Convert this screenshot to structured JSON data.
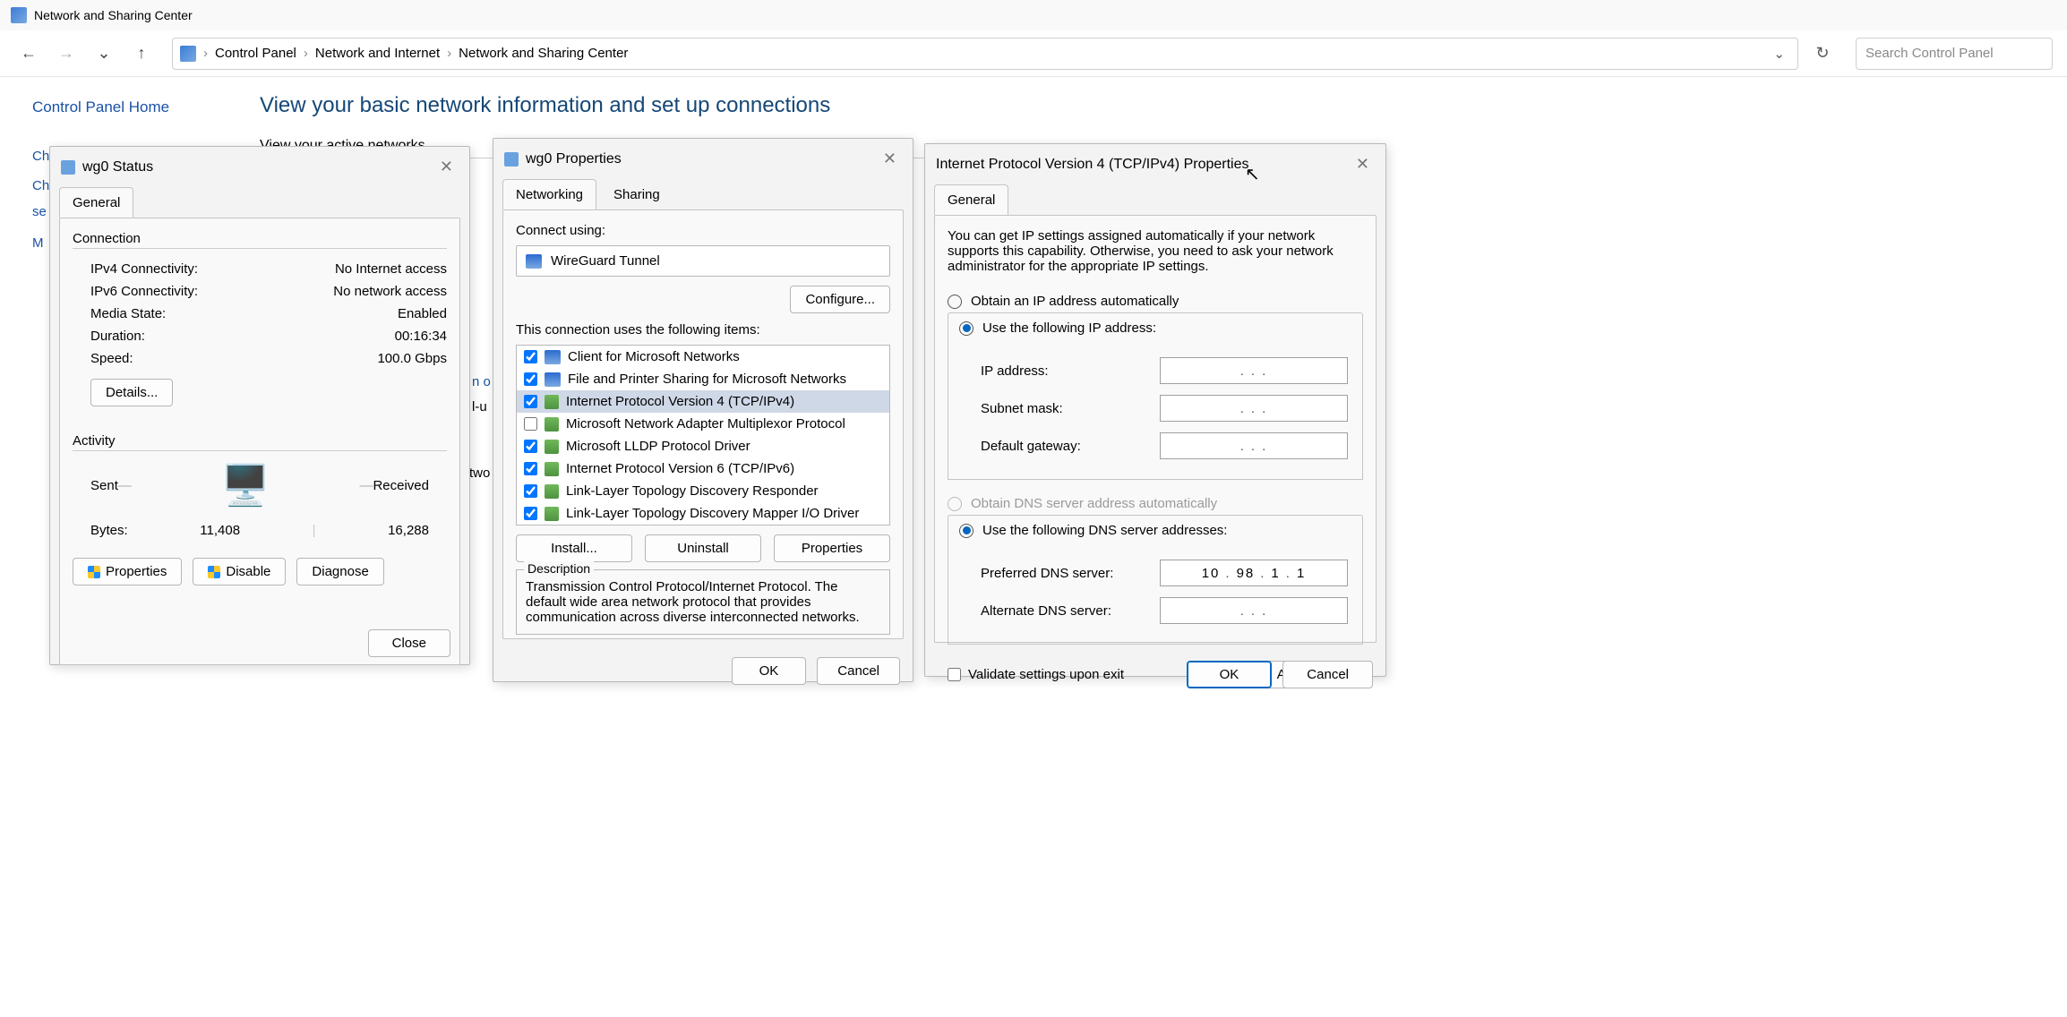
{
  "window": {
    "title": "Network and Sharing Center"
  },
  "toolbar": {
    "breadcrumb": [
      "Control Panel",
      "Network and Internet",
      "Network and Sharing Center"
    ],
    "search_placeholder": "Search Control Panel"
  },
  "sidebar": {
    "home": "Control Panel Home",
    "links": [
      "Change adapter settings",
      "Ch",
      "se",
      "M"
    ]
  },
  "content": {
    "heading": "View your basic network information and set up connections",
    "subhead": "View your active networks",
    "peek1": "n o",
    "peek2": "l-u",
    "peek3": "two"
  },
  "status": {
    "title": "wg0 Status",
    "tab": "General",
    "section_conn": "Connection",
    "ipv4_l": "IPv4 Connectivity:",
    "ipv4_v": "No Internet access",
    "ipv6_l": "IPv6 Connectivity:",
    "ipv6_v": "No network access",
    "media_l": "Media State:",
    "media_v": "Enabled",
    "dur_l": "Duration:",
    "dur_v": "00:16:34",
    "speed_l": "Speed:",
    "speed_v": "100.0 Gbps",
    "details": "Details...",
    "section_act": "Activity",
    "sent_l": "Sent",
    "recv_l": "Received",
    "bytes_l": "Bytes:",
    "sent_v": "11,408",
    "recv_v": "16,288",
    "props": "Properties",
    "disable": "Disable",
    "diag": "Diagnose",
    "close": "Close"
  },
  "props": {
    "title": "wg0 Properties",
    "tab_net": "Networking",
    "tab_share": "Sharing",
    "connect_using": "Connect using:",
    "adapter": "WireGuard Tunnel",
    "configure": "Configure...",
    "items_label": "This connection uses the following items:",
    "items": [
      {
        "checked": true,
        "icon": "pc",
        "label": "Client for Microsoft Networks"
      },
      {
        "checked": true,
        "icon": "pc",
        "label": "File and Printer Sharing for Microsoft Networks"
      },
      {
        "checked": true,
        "icon": "net",
        "label": "Internet Protocol Version 4 (TCP/IPv4)",
        "selected": true
      },
      {
        "checked": false,
        "icon": "net",
        "label": "Microsoft Network Adapter Multiplexor Protocol"
      },
      {
        "checked": true,
        "icon": "net",
        "label": "Microsoft LLDP Protocol Driver"
      },
      {
        "checked": true,
        "icon": "net",
        "label": "Internet Protocol Version 6 (TCP/IPv6)"
      },
      {
        "checked": true,
        "icon": "net",
        "label": "Link-Layer Topology Discovery Responder"
      },
      {
        "checked": true,
        "icon": "net",
        "label": "Link-Layer Topology Discovery Mapper I/O Driver"
      }
    ],
    "install": "Install...",
    "uninstall": "Uninstall",
    "properties": "Properties",
    "desc_legend": "Description",
    "desc": "Transmission Control Protocol/Internet Protocol. The default wide area network protocol that provides communication across diverse interconnected networks.",
    "ok": "OK",
    "cancel": "Cancel"
  },
  "ipv4": {
    "title": "Internet Protocol Version 4 (TCP/IPv4) Properties",
    "tab": "General",
    "intro": "You can get IP settings assigned automatically if your network supports this capability. Otherwise, you need to ask your network administrator for the appropriate IP settings.",
    "r_auto": "Obtain an IP address automatically",
    "r_manual": "Use the following IP address:",
    "ip_l": "IP address:",
    "mask_l": "Subnet mask:",
    "gw_l": "Default gateway:",
    "r_dns_auto": "Obtain DNS server address automatically",
    "r_dns_manual": "Use the following DNS server addresses:",
    "dns1_l": "Preferred DNS server:",
    "dns1_v": [
      "10",
      "98",
      "1",
      "1"
    ],
    "dns2_l": "Alternate DNS server:",
    "validate": "Validate settings upon exit",
    "advanced": "Advanced...",
    "ok": "OK",
    "cancel": "Cancel"
  }
}
